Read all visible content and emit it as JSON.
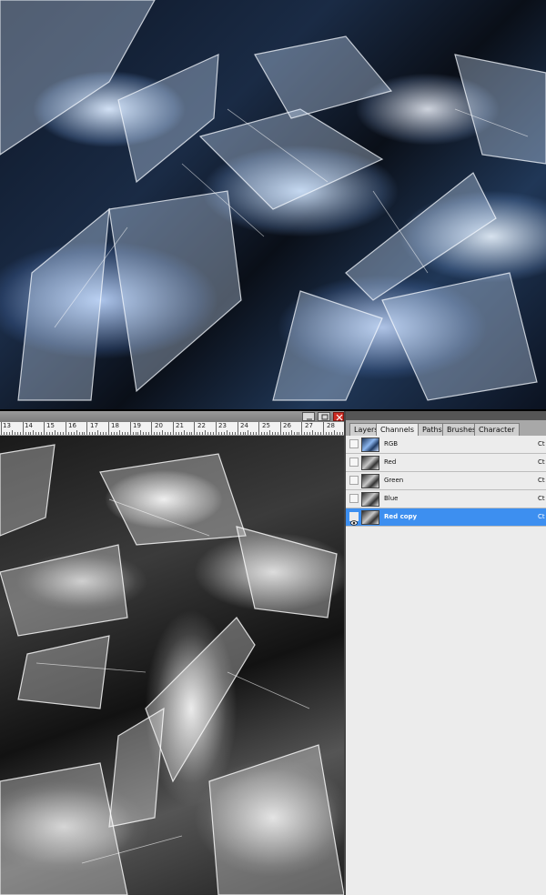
{
  "window": {
    "controls": {
      "minimize_icon": "minimize-icon",
      "restore_icon": "restore-icon",
      "close_icon": "close-icon"
    }
  },
  "ruler": {
    "labels": [
      "13",
      "14",
      "15",
      "16",
      "17",
      "18",
      "19",
      "20",
      "21",
      "22",
      "23",
      "24",
      "25",
      "26",
      "27",
      "28"
    ]
  },
  "panel": {
    "tabs": [
      {
        "label": "Layers"
      },
      {
        "label": "Channels",
        "active": true
      },
      {
        "label": "Paths"
      },
      {
        "label": "Brushes"
      },
      {
        "label": "Character"
      }
    ],
    "channels": [
      {
        "name": "RGB",
        "shortcut": "Ct",
        "visible": false
      },
      {
        "name": "Red",
        "shortcut": "Ct",
        "visible": false
      },
      {
        "name": "Green",
        "shortcut": "Ct",
        "visible": false
      },
      {
        "name": "Blue",
        "shortcut": "Ct",
        "visible": false
      },
      {
        "name": "Red copy",
        "shortcut": "Ct",
        "visible": true,
        "selected": true
      }
    ]
  },
  "colors": {
    "selection": "#3d8ff0",
    "close_button": "#cc2b22"
  }
}
